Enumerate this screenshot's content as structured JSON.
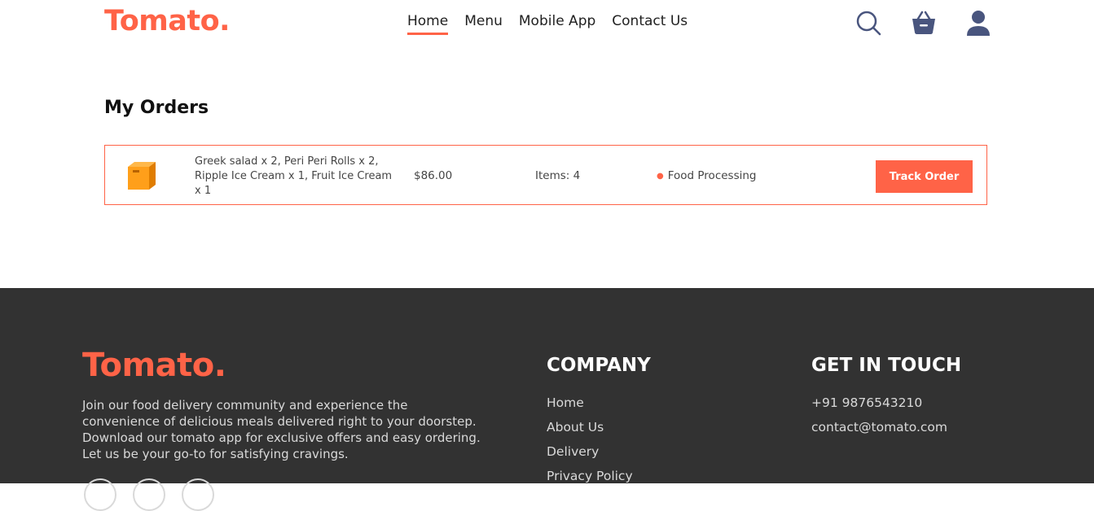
{
  "brand": {
    "logo": "Tomato."
  },
  "nav": {
    "items": [
      {
        "label": "Home",
        "active": true
      },
      {
        "label": "Menu",
        "active": false
      },
      {
        "label": "Mobile App",
        "active": false
      },
      {
        "label": "Contact Us",
        "active": false
      }
    ],
    "icons": [
      "search-icon",
      "basket-icon",
      "profile-icon"
    ]
  },
  "orders": {
    "title": "My Orders",
    "list": [
      {
        "icon": "parcel-icon",
        "items": "Greek salad x 2, Peri Peri Rolls x 2, Ripple Ice Cream x 1, Fruit Ice Cream x 1",
        "amount": "$86.00",
        "count": "Items: 4",
        "status": "Food Processing",
        "button": "Track Order"
      }
    ]
  },
  "footer": {
    "logo": "Tomato.",
    "description": "Join our food delivery community and experience the convenience of delicious meals delivered right to your doorstep. Download our tomato app for exclusive offers and easy ordering. Let us be your go-to for satisfying cravings.",
    "company": {
      "heading": "COMPANY",
      "links": [
        "Home",
        "About Us",
        "Delivery",
        "Privacy Policy"
      ]
    },
    "contact": {
      "heading": "GET IN TOUCH",
      "phone": "+91 9876543210",
      "email": "contact@tomato.com"
    }
  },
  "colors": {
    "accent": "#ff6347",
    "footer_bg": "#323232",
    "nav_icon": "#49557e"
  }
}
